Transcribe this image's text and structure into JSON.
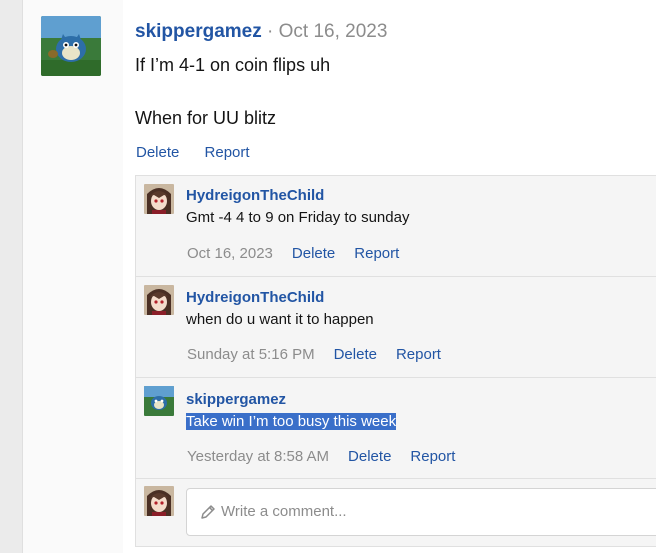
{
  "post": {
    "username": "skippergamez",
    "separator": "·",
    "date": "Oct 16, 2023",
    "body_lines": [
      "If I’m 4-1 on coin flips uh",
      "When for UU blitz"
    ],
    "actions": {
      "delete": "Delete",
      "report": "Report"
    }
  },
  "comments": [
    {
      "username": "HydreigonTheChild",
      "text": "Gmt -4 4 to 9 on Friday to sunday",
      "time": "Oct 16, 2023",
      "delete": "Delete",
      "report": "Report"
    },
    {
      "username": "HydreigonTheChild",
      "text": "when do u want it to happen",
      "time": "Sunday at 5:16 PM",
      "delete": "Delete",
      "report": "Report"
    },
    {
      "username": "skippergamez",
      "text": "Take win I’m too busy this week",
      "time": "Yesterday at 8:58 AM",
      "delete": "Delete",
      "report": "Report",
      "selected": true
    }
  ],
  "reply": {
    "placeholder": "Write a comment..."
  },
  "colors": {
    "link": "#2255a4",
    "muted": "#8c8c8c",
    "selection": "#3a6fc9"
  }
}
